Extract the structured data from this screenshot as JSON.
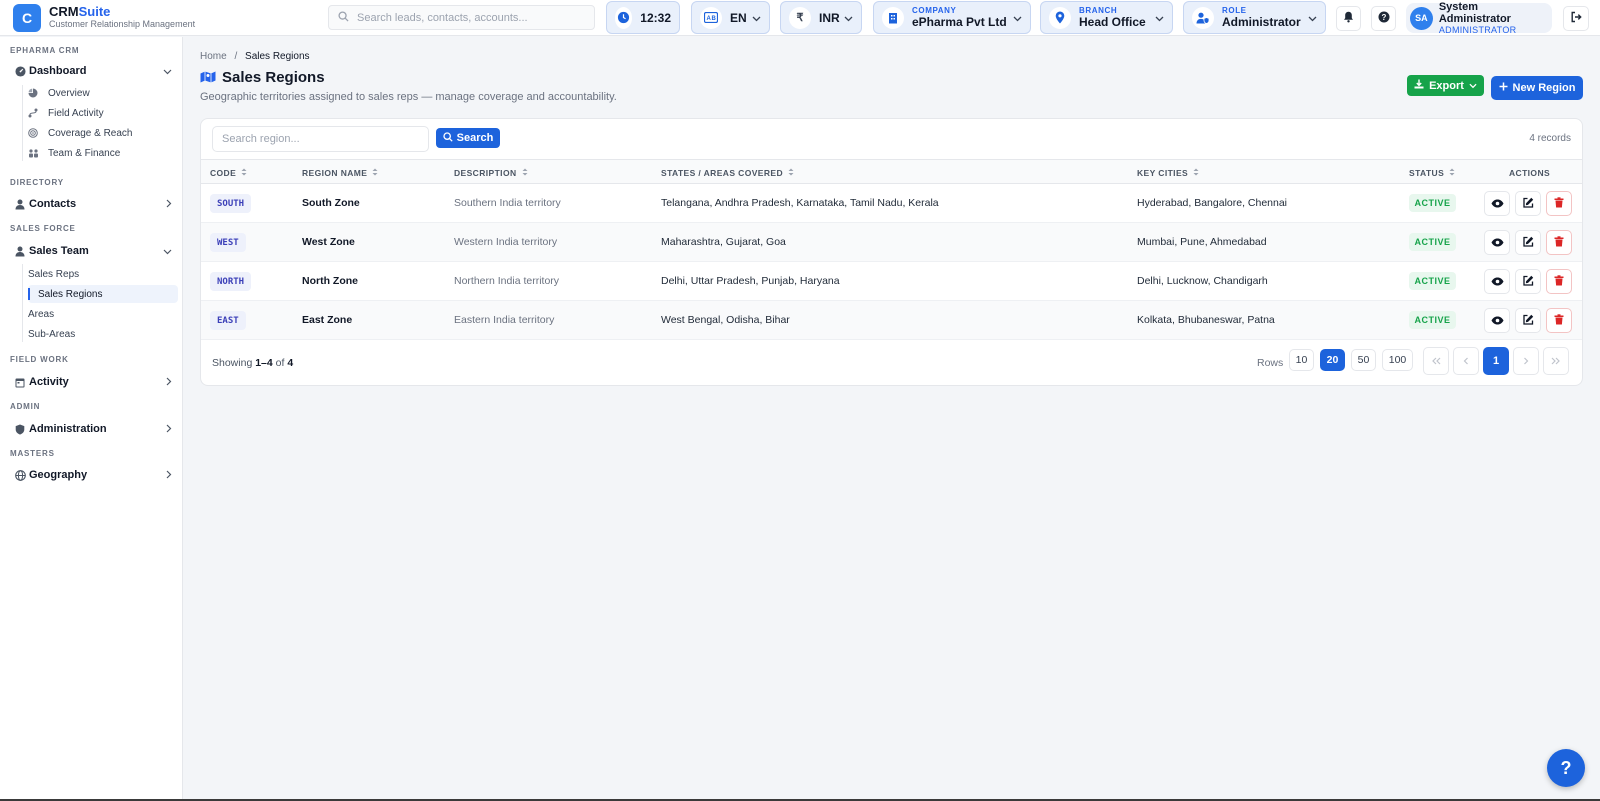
{
  "brand": {
    "logo_letter": "C",
    "name_part1": "CRM",
    "name_part2": "Suite",
    "subtitle": "Customer Relationship Management"
  },
  "header": {
    "search_placeholder": "Search leads, contacts, accounts...",
    "clock": "12:32",
    "language": "EN",
    "currency_symbol": "₹",
    "currency": "INR",
    "company_caption": "COMPANY",
    "company_value": "ePharma Pvt Ltd",
    "branch_caption": "BRANCH",
    "branch_value": "Head Office",
    "role_caption": "ROLE",
    "role_value": "Administrator",
    "user_initials": "SA",
    "user_name": "System Administrator",
    "user_role": "ADMINISTRATOR"
  },
  "sidebar": {
    "sections": {
      "epharma": "EPHARMA CRM",
      "directory": "DIRECTORY",
      "sales_force": "SALES FORCE",
      "field_work": "FIELD WORK",
      "admin": "ADMIN",
      "masters": "MASTERS"
    },
    "dashboard": "Dashboard",
    "dashboard_items": [
      "Overview",
      "Field Activity",
      "Coverage & Reach",
      "Team & Finance"
    ],
    "contacts": "Contacts",
    "sales_team": "Sales Team",
    "sales_team_items": [
      "Sales Reps",
      "Sales Regions",
      "Areas",
      "Sub-Areas"
    ],
    "activity": "Activity",
    "administration": "Administration",
    "geography": "Geography"
  },
  "page": {
    "breadcrumb_home": "Home",
    "breadcrumb_sep": "/",
    "breadcrumb_current": "Sales Regions",
    "title": "Sales Regions",
    "subtitle": "Geographic territories assigned to sales reps — manage coverage and accountability.",
    "export_label": "Export",
    "new_label": "New Region"
  },
  "table": {
    "search_placeholder": "Search region...",
    "search_button": "Search",
    "records": "4 records",
    "columns": [
      "CODE",
      "REGION NAME",
      "DESCRIPTION",
      "STATES / AREAS COVERED",
      "KEY CITIES",
      "STATUS",
      "ACTIONS"
    ],
    "rows": [
      {
        "code": "SOUTH",
        "name": "South Zone",
        "description": "Southern India territory",
        "states": "Telangana, Andhra Pradesh, Karnataka, Tamil Nadu, Kerala",
        "cities": "Hyderabad, Bangalore, Chennai",
        "status": "ACTIVE"
      },
      {
        "code": "WEST",
        "name": "West Zone",
        "description": "Western India territory",
        "states": "Maharashtra, Gujarat, Goa",
        "cities": "Mumbai, Pune, Ahmedabad",
        "status": "ACTIVE"
      },
      {
        "code": "NORTH",
        "name": "North Zone",
        "description": "Northern India territory",
        "states": "Delhi, Uttar Pradesh, Punjab, Haryana",
        "cities": "Delhi, Lucknow, Chandigarh",
        "status": "ACTIVE"
      },
      {
        "code": "EAST",
        "name": "East Zone",
        "description": "Eastern India territory",
        "states": "West Bengal, Odisha, Bihar",
        "cities": "Kolkata, Bhubaneswar, Patna",
        "status": "ACTIVE"
      }
    ]
  },
  "pagination": {
    "showing_prefix": "Showing",
    "range": "1–4",
    "of": "of",
    "total": "4",
    "rows_label": "Rows",
    "sizes": [
      "10",
      "20",
      "50",
      "100"
    ],
    "current_page": "1"
  },
  "help": "?",
  "colors": {
    "primary": "#1d63dc",
    "success": "#16a34a",
    "danger": "#dc2626"
  }
}
